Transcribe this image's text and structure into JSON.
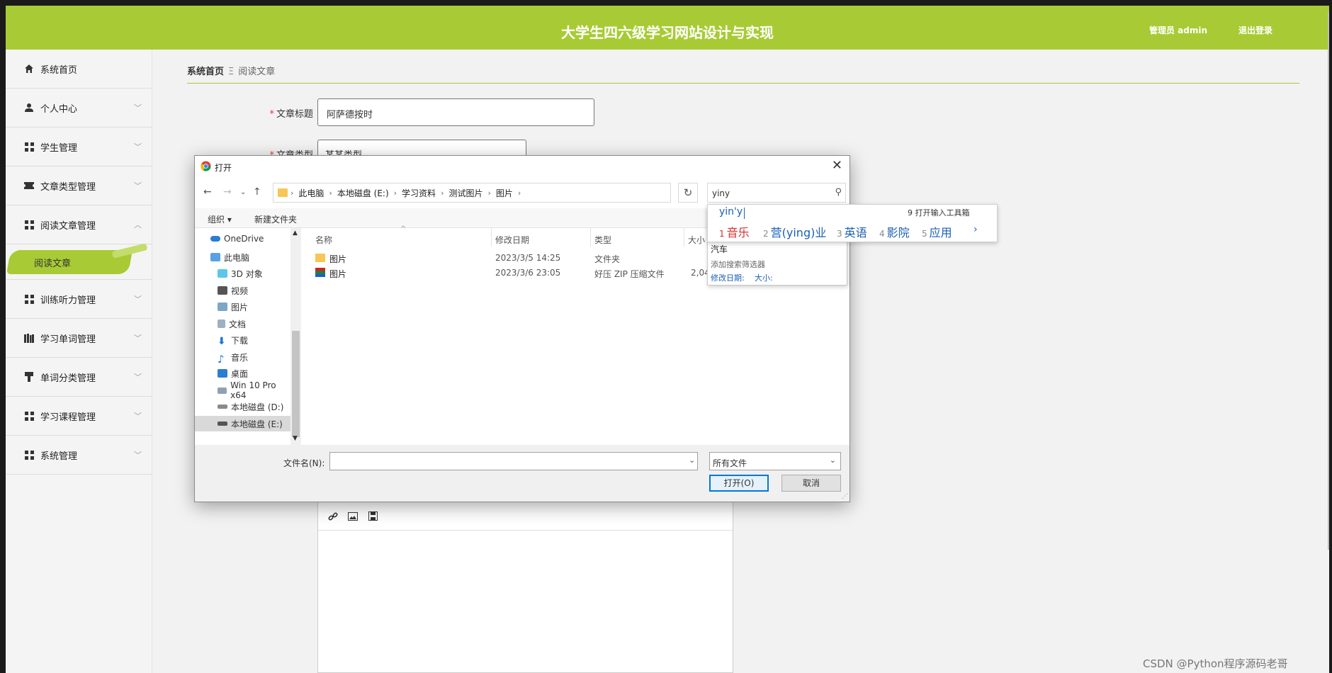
{
  "header": {
    "title": "大学生四六级学习网站设计与实现",
    "admin": "管理员 admin",
    "logout": "退出登录"
  },
  "sidebar": {
    "items": [
      {
        "label": "系统首页"
      },
      {
        "label": "个人中心"
      },
      {
        "label": "学生管理"
      },
      {
        "label": "文章类型管理"
      },
      {
        "label": "阅读文章管理"
      },
      {
        "label": "训练听力管理"
      },
      {
        "label": "学习单词管理"
      },
      {
        "label": "单词分类管理"
      },
      {
        "label": "学习课程管理"
      },
      {
        "label": "系统管理"
      }
    ],
    "active_sub": "阅读文章"
  },
  "breadcrumb": {
    "home": "系统首页",
    "current": "阅读文章"
  },
  "form": {
    "title_label": "文章标题",
    "title_value": "阿萨德按时",
    "type_label": "文章类型",
    "type_value": "某某类型"
  },
  "dialog": {
    "title": "打开",
    "path": [
      "此电脑",
      "本地磁盘 (E:)",
      "学习资料",
      "测试图片",
      "图片"
    ],
    "search_value": "yiny",
    "toolbar": {
      "organize": "组织",
      "new_folder": "新建文件夹"
    },
    "tree": [
      "OneDrive",
      "此电脑",
      "3D 对象",
      "视频",
      "图片",
      "文档",
      "下载",
      "音乐",
      "桌面",
      "Win 10 Pro x64",
      "本地磁盘 (D:)",
      "本地磁盘 (E:)"
    ],
    "columns": {
      "name": "名称",
      "date": "修改日期",
      "type": "类型",
      "size": "大小"
    },
    "files": [
      {
        "name": "图片",
        "date": "2023/3/5 14:25",
        "type": "文件夹",
        "size": ""
      },
      {
        "name": "图片",
        "date": "2023/3/6 23:05",
        "type": "好压 ZIP 压缩文件",
        "size": "2,04"
      }
    ],
    "filename_label": "文件名(N):",
    "filename_value": "",
    "filetype": "所有文件",
    "open_button": "打开(O)",
    "cancel_button": "取消"
  },
  "search_suggest": {
    "item": "汽车",
    "add_filter": "添加搜索筛选器",
    "filter_date": "修改日期:",
    "filter_size": "大小:"
  },
  "ime": {
    "composition": "yin'y",
    "tool": "9 打开输入工具箱",
    "candidates": [
      {
        "num": "1",
        "text": "音乐"
      },
      {
        "num": "2",
        "text": "营(ying)业"
      },
      {
        "num": "3",
        "text": "英语"
      },
      {
        "num": "4",
        "text": "影院"
      },
      {
        "num": "5",
        "text": "应用"
      }
    ],
    "next": "›"
  },
  "watermark": "CSDN @Python程序源码老哥",
  "colors": {
    "accent": "#a8cb35",
    "link": "#1a5fb4"
  }
}
